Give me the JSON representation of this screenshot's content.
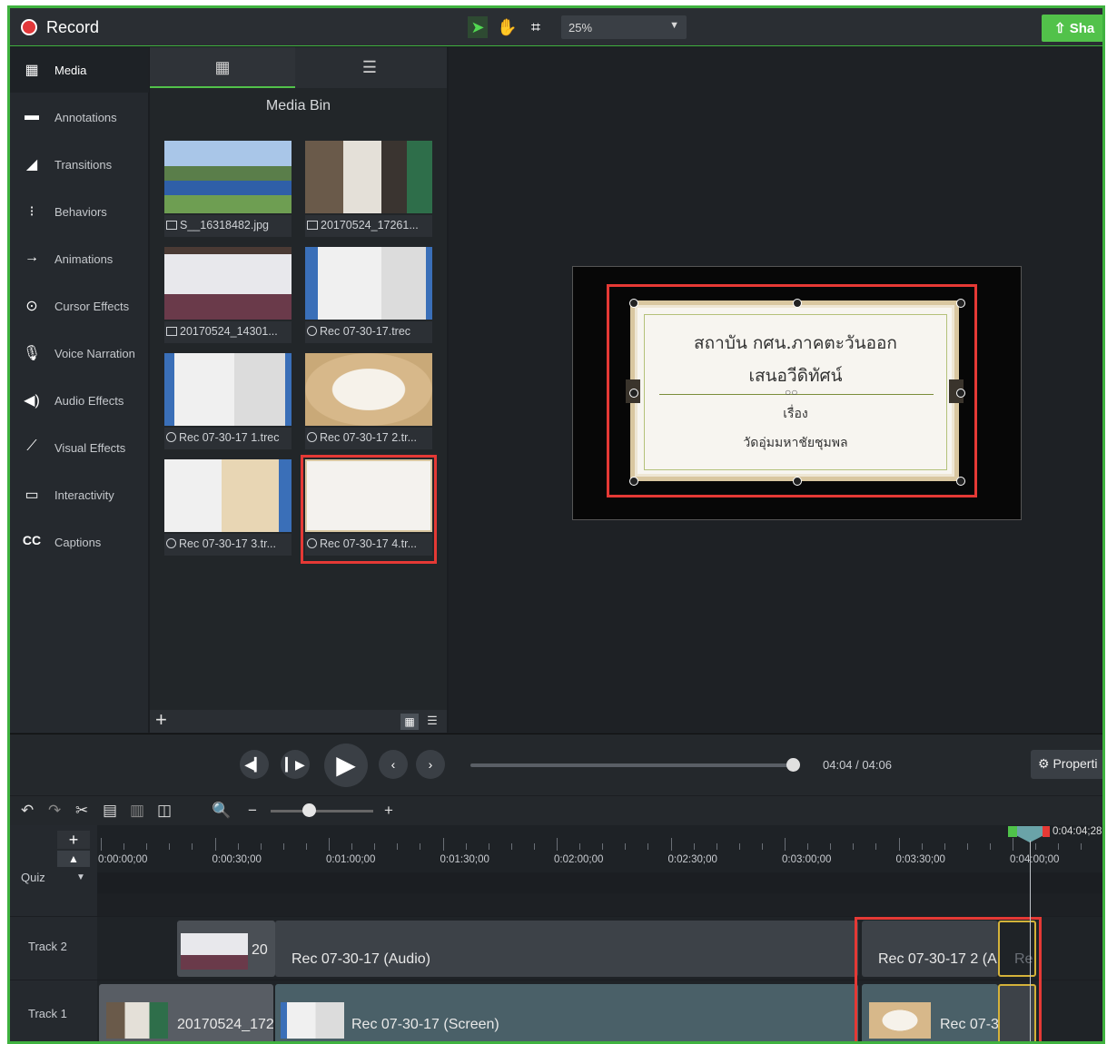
{
  "topbar": {
    "record_label": "Record",
    "zoom_value": "25%",
    "share_label": "Sha"
  },
  "leftnav": [
    {
      "label": "Media",
      "icon": "film-icon",
      "active": true
    },
    {
      "label": "Annotations",
      "icon": "annotation-icon"
    },
    {
      "label": "Transitions",
      "icon": "transition-icon"
    },
    {
      "label": "Behaviors",
      "icon": "behaviors-icon"
    },
    {
      "label": "Animations",
      "icon": "animation-arrow-icon"
    },
    {
      "label": "Cursor Effects",
      "icon": "cursor-icon"
    },
    {
      "label": "Voice Narration",
      "icon": "microphone-icon"
    },
    {
      "label": "Audio Effects",
      "icon": "speaker-icon"
    },
    {
      "label": "Visual Effects",
      "icon": "wand-icon"
    },
    {
      "label": "Interactivity",
      "icon": "interactivity-icon"
    },
    {
      "label": "Captions",
      "icon": "cc-icon"
    }
  ],
  "media_bin": {
    "title": "Media Bin",
    "items": [
      {
        "caption": "S__16318482.jpg",
        "type": "image"
      },
      {
        "caption": "20170524_17261...",
        "type": "video"
      },
      {
        "caption": "20170524_14301...",
        "type": "video"
      },
      {
        "caption": "Rec 07-30-17.trec",
        "type": "recording"
      },
      {
        "caption": "Rec 07-30-17 1.trec",
        "type": "recording"
      },
      {
        "caption": "Rec 07-30-17 2.tr...",
        "type": "recording"
      },
      {
        "caption": "Rec 07-30-17 3.tr...",
        "type": "recording"
      },
      {
        "caption": "Rec 07-30-17 4.tr...",
        "type": "recording",
        "selected": true
      }
    ]
  },
  "slide": {
    "line1": "สถาบัน กศน.ภาคตะวันออก",
    "line2": "เสนอวีดิทัศน์",
    "line3": "เรื่อง",
    "line4": "วัดอุ่มมหาชัยชุมพล"
  },
  "playback": {
    "time_current": "04:04",
    "time_sep": "/",
    "time_total": "04:06",
    "properties_label": "Properti"
  },
  "timeline": {
    "quiz_label": "Quiz",
    "playhead_time": "0:04:04;28",
    "ruler_labels": [
      "0:00:00;00",
      "0:00:30;00",
      "0:01:00;00",
      "0:01:30;00",
      "0:02:00;00",
      "0:02:30;00",
      "0:03:00;00",
      "0:03:30;00",
      "0:04:00;00"
    ],
    "tracks": [
      {
        "name": "Track 2",
        "clips": [
          "20",
          "Rec 07-30-17 (Audio)",
          "Rec 07-30-17 2 (A",
          "Re"
        ]
      },
      {
        "name": "Track 1",
        "clips": [
          "20170524_172",
          "Rec 07-30-17 (Screen)",
          "Rec 07-3"
        ]
      }
    ]
  }
}
